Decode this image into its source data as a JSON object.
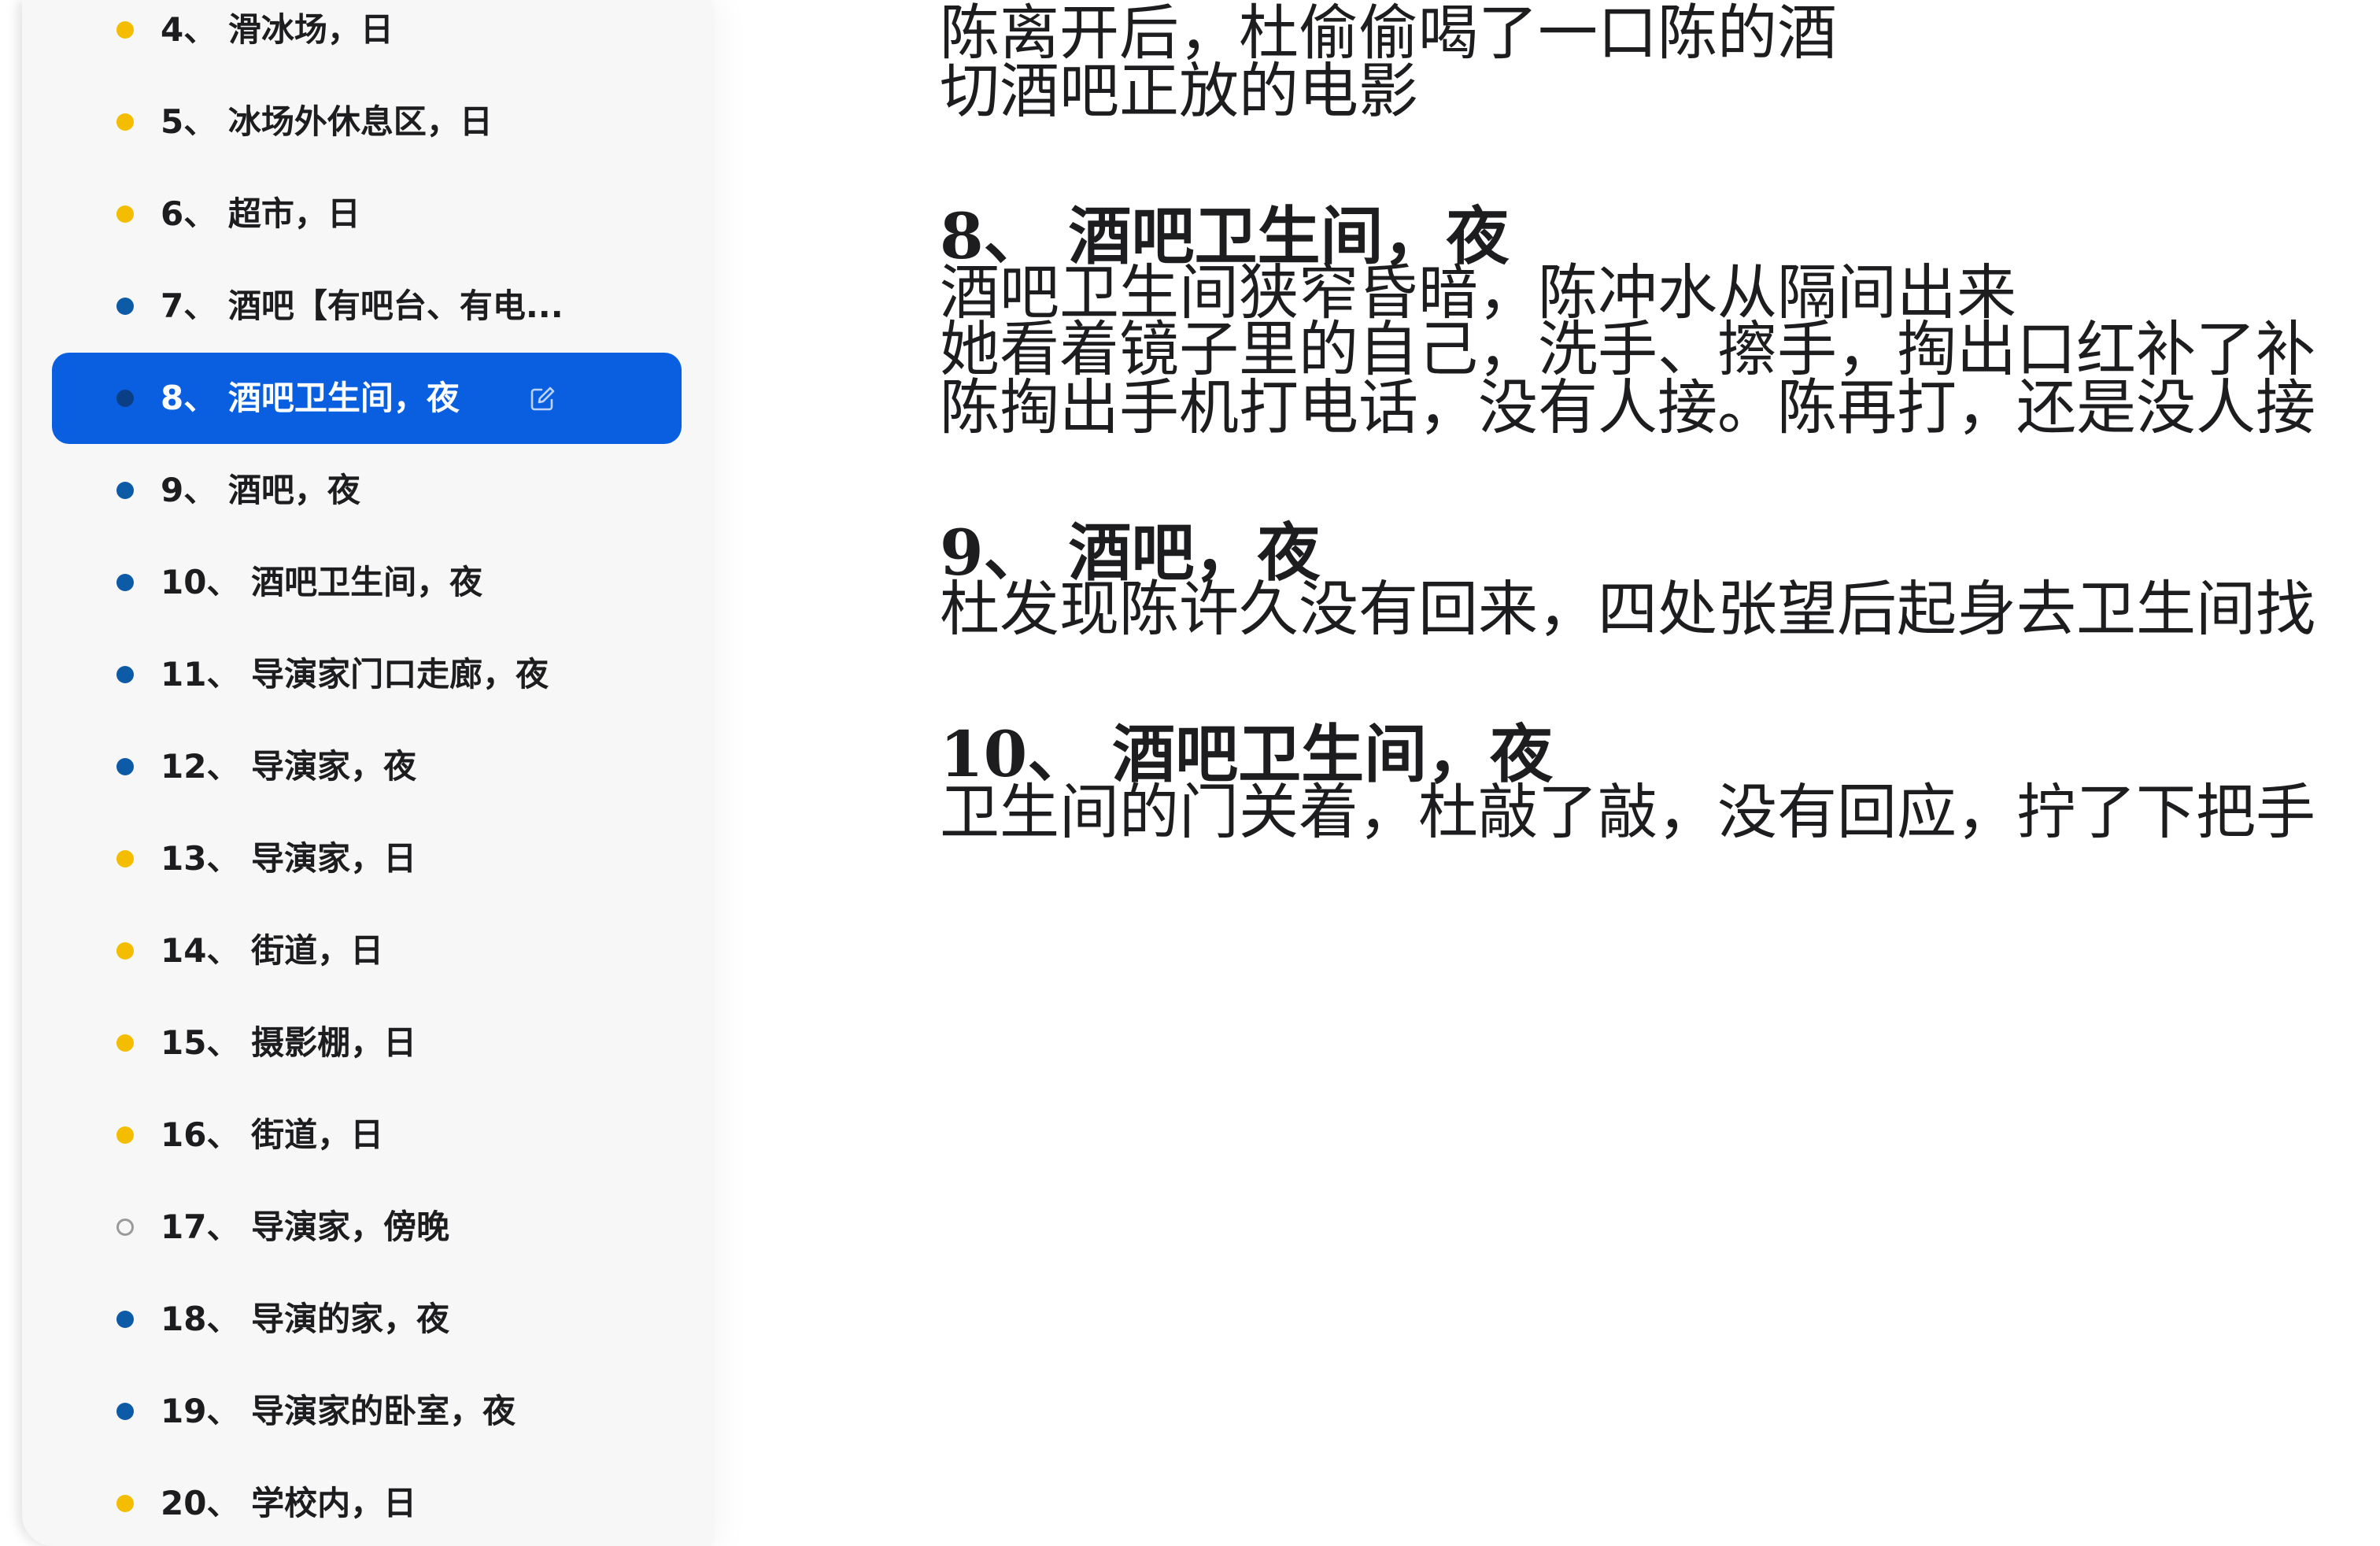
{
  "sidebar": {
    "items": [
      {
        "label": "4、 滑冰场，日",
        "time": "day"
      },
      {
        "label": "5、 冰场外休息区，日",
        "time": "day"
      },
      {
        "label": "6、 超市，日",
        "time": "day"
      },
      {
        "label": "7、 酒吧【有吧台、有电...",
        "time": "night"
      },
      {
        "label": "8、 酒吧卫生间，夜",
        "time": "night",
        "active": true
      },
      {
        "label": "9、 酒吧，夜",
        "time": "night"
      },
      {
        "label": "10、 酒吧卫生间，夜",
        "time": "night"
      },
      {
        "label": "11、 导演家门口走廊，夜",
        "time": "night"
      },
      {
        "label": "12、 导演家，夜",
        "time": "night"
      },
      {
        "label": "13、 导演家，日",
        "time": "day"
      },
      {
        "label": "14、 街道，日",
        "time": "day"
      },
      {
        "label": "15、 摄影棚，日",
        "time": "day"
      },
      {
        "label": "16、 街道，日",
        "time": "day"
      },
      {
        "label": "17、 导演家，傍晚",
        "time": "dusk"
      },
      {
        "label": "18、 导演的家，夜",
        "time": "night"
      },
      {
        "label": "19、 导演家的卧室，夜",
        "time": "night"
      },
      {
        "label": "20、 学校内，日",
        "time": "day"
      }
    ],
    "active_edit_icon": "edit-icon",
    "colors": {
      "day_dot": "#f5bd00",
      "night_dot": "#0d5aa7",
      "dusk_dot": "#9a9a9a",
      "active_bg": "#0a5fe0"
    }
  },
  "document": {
    "lines": [
      {
        "type": "text",
        "text": "陈离开后，杜偷偷喝了一口陈的酒"
      },
      {
        "type": "text",
        "text": "切酒吧正放的电影"
      },
      {
        "type": "heading",
        "text": "8、 酒吧卫生间，夜"
      },
      {
        "type": "text",
        "text": "酒吧卫生间狭窄昏暗，陈冲水从隔间出来"
      },
      {
        "type": "text",
        "text": "她看着镜子里的自己，洗手、擦手，掏出口红补了补"
      },
      {
        "type": "text",
        "text": "陈掏出手机打电话，没有人接。陈再打，还是没人接"
      },
      {
        "type": "heading",
        "text": "9、 酒吧，夜"
      },
      {
        "type": "text",
        "text": "杜发现陈许久没有回来，四处张望后起身去卫生间找"
      },
      {
        "type": "heading",
        "text": "10、 酒吧卫生间，夜"
      },
      {
        "type": "text",
        "text": "卫生间的门关着，杜敲了敲，没有回应，拧了下把手"
      }
    ]
  }
}
